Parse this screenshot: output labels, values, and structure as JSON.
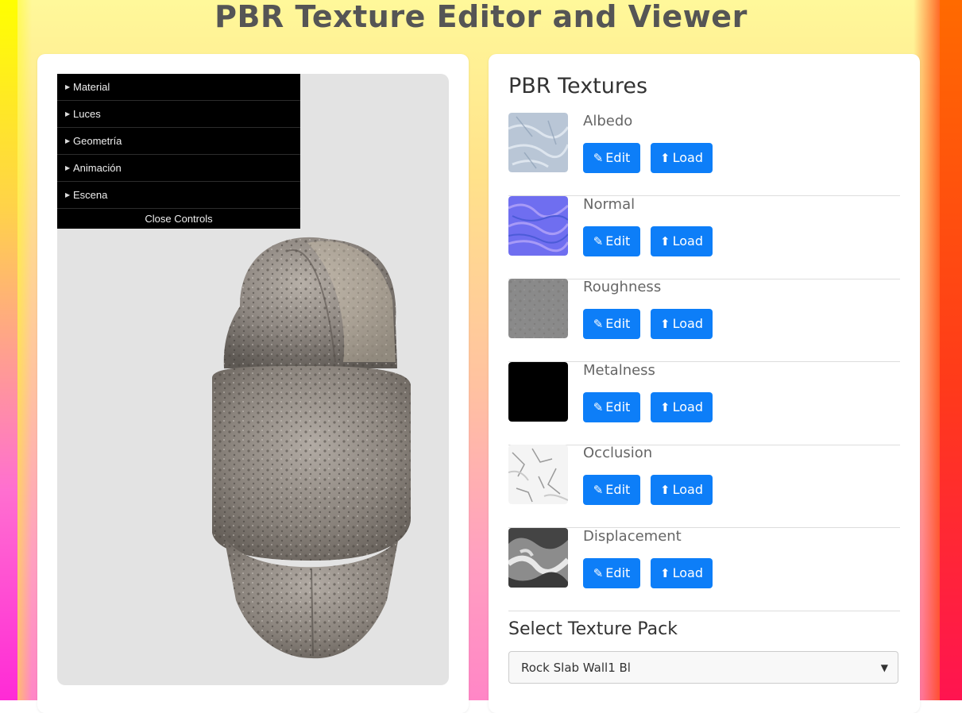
{
  "page": {
    "title": "PBR Texture Editor and Viewer"
  },
  "controls": {
    "folders": [
      "Material",
      "Luces",
      "Geometría",
      "Animación",
      "Escena"
    ],
    "close_label": "Close Controls"
  },
  "textures": {
    "heading": "PBR Textures",
    "items": [
      {
        "name": "Albedo",
        "edit": "Edit",
        "load": "Load",
        "thumb_color": "#b9c6d6"
      },
      {
        "name": "Normal",
        "edit": "Edit",
        "load": "Load",
        "thumb_color": "#6f6ef0"
      },
      {
        "name": "Roughness",
        "edit": "Edit",
        "load": "Load",
        "thumb_color": "#8a8a8a"
      },
      {
        "name": "Metalness",
        "edit": "Edit",
        "load": "Load",
        "thumb_color": "#000000"
      },
      {
        "name": "Occlusion",
        "edit": "Edit",
        "load": "Load",
        "thumb_color": "#f2f2f2"
      },
      {
        "name": "Displacement",
        "edit": "Edit",
        "load": "Load",
        "thumb_color": "#9a9a9a"
      }
    ]
  },
  "pack": {
    "heading": "Select Texture Pack",
    "selected": "Rock Slab Wall1 Bl"
  },
  "colors": {
    "button": "#0d7ef8",
    "accent_left": "#ffff00",
    "accent_right": "#ff3a1a"
  }
}
